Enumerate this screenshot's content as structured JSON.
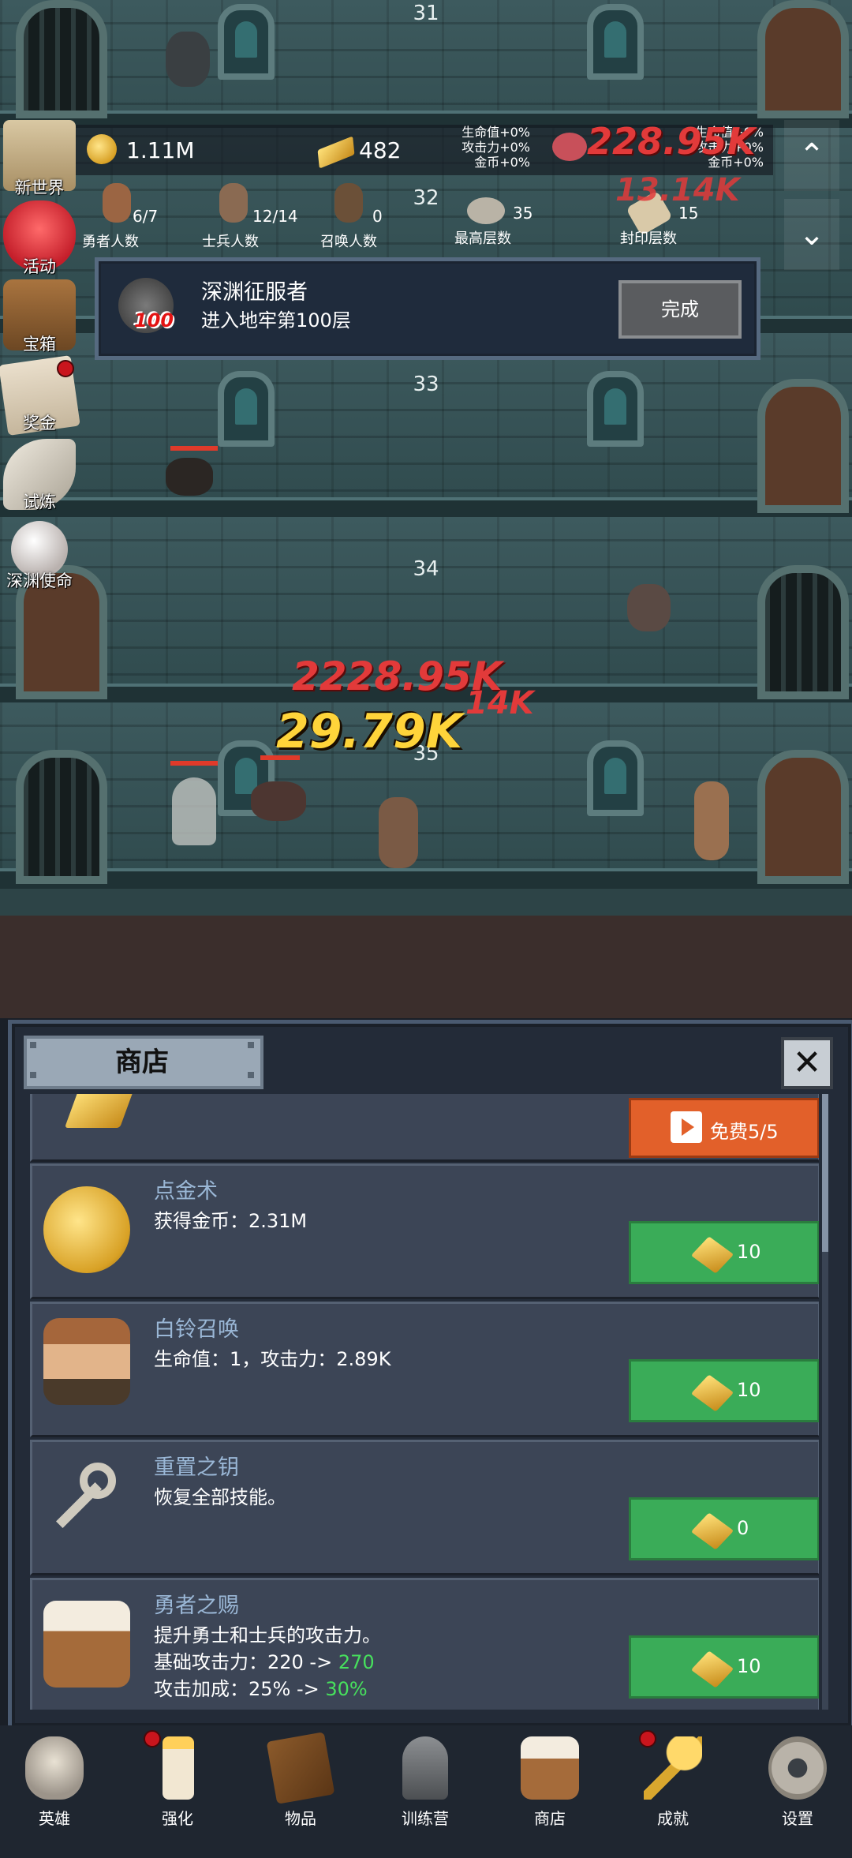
{
  "floors": [
    "31",
    "32",
    "33",
    "34",
    "35"
  ],
  "resources": {
    "coins": "1.11M",
    "gold_bars": "482",
    "stats_left": [
      "生命值+0%",
      "攻击力+0%",
      "金币+0%"
    ],
    "stats_right": [
      "生命值+0%",
      "攻击力+0%",
      "金币+0%"
    ]
  },
  "stats": {
    "hero_count": "6/7",
    "hero_label": "勇者人数",
    "soldier_count": "12/14",
    "soldier_label": "士兵人数",
    "summon_count": "0",
    "summon_label": "召唤人数",
    "max_floor": "35",
    "max_floor_label": "最高层数",
    "seal_floor": "15",
    "seal_floor_label": "封印层数"
  },
  "sidebar": [
    {
      "label": "新世界"
    },
    {
      "label": "活动"
    },
    {
      "label": "宝箱"
    },
    {
      "label": "奖金"
    },
    {
      "label": "试炼"
    },
    {
      "label": "深渊使命"
    }
  ],
  "achievement": {
    "title": "深渊征服者",
    "description": "进入地牢第100层",
    "badge": "100",
    "button": "完成"
  },
  "damage": {
    "top_red": "228.95K",
    "top_red2": "13.14K",
    "mid_red": "2228.95K",
    "mid_red2": "14K",
    "mid_yellow": "29.79K"
  },
  "shop": {
    "title": "商店",
    "close": "✕",
    "free_button": "免费5/5",
    "items": [
      {
        "name": "点金术",
        "desc": [
          "获得金币：2.31M"
        ],
        "price": "10"
      },
      {
        "name": "白铃召唤",
        "desc": [
          "生命值：1，攻击力：2.89K"
        ],
        "price": "10"
      },
      {
        "name": "重置之钥",
        "desc": [
          "恢复全部技能。"
        ],
        "price": "0"
      },
      {
        "name": "勇者之赐",
        "desc": [
          "提升勇士和士兵的攻击力。"
        ],
        "price": "10",
        "line2_prefix": "基础攻击力：220 -> ",
        "line2_new": "270",
        "line3_prefix": "攻击加成：25% -> ",
        "line3_new": "30%"
      }
    ]
  },
  "nav": [
    {
      "label": "英雄"
    },
    {
      "label": "强化"
    },
    {
      "label": "物品"
    },
    {
      "label": "训练营"
    },
    {
      "label": "商店"
    },
    {
      "label": "成就"
    },
    {
      "label": "设置"
    }
  ],
  "colors": {
    "accent_green": "#3aac58",
    "free_orange": "#e2602a",
    "name_blue": "#9ab7d6",
    "damage_red": "#e23a3a",
    "damage_yellow": "#ffd43a"
  }
}
